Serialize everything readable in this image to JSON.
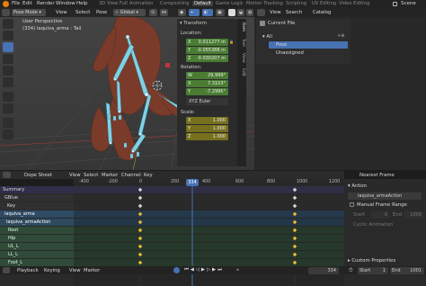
{
  "menus": [
    "File",
    "Edit",
    "Render",
    "Window",
    "Help"
  ],
  "workspace_tabs": [
    "3D View Full",
    "Animation",
    "Compositing",
    "Default",
    "Game Logic",
    "Motion Tracking",
    "Scripting",
    "UV Editing",
    "Video Editing"
  ],
  "active_workspace": "Default",
  "scene_label": "Scene",
  "viewport": {
    "mode": "Pose Mode",
    "menu": [
      "View",
      "Select",
      "Pose"
    ],
    "orientation": "Global",
    "overlay_title": "User Perspective",
    "overlay_subtitle": "(334) laquiva_arma : Tail"
  },
  "transform": {
    "title": "Transform",
    "location_label": "Location:",
    "location": [
      {
        "axis": "X",
        "value": "0.011277 m"
      },
      {
        "axis": "Y",
        "value": "-0.055388 m"
      },
      {
        "axis": "Z",
        "value": "-0.030207 m"
      }
    ],
    "rotation_label": "Rotation:",
    "rotation": [
      {
        "axis": "W",
        "value": "29.999°"
      },
      {
        "axis": "X",
        "value": "7.3103°"
      },
      {
        "axis": "Y",
        "value": "-7.2995°"
      }
    ],
    "rotation_mode": "XYZ Euler",
    "scale_label": "Scale:",
    "scale": [
      {
        "axis": "X",
        "value": "1.000"
      },
      {
        "axis": "Y",
        "value": "1.000"
      },
      {
        "axis": "Z",
        "value": "1.000"
      }
    ]
  },
  "npanel_tabs": [
    "Item",
    "Tool",
    "View",
    "Edit"
  ],
  "outliner": {
    "menu": [
      "View",
      "Search",
      "Catalog"
    ],
    "current_file": "Current File",
    "items": [
      "All",
      "Pose",
      "Unassigned"
    ],
    "selected": "Pose"
  },
  "dopesheet": {
    "mode": "Dope Sheet",
    "menu": [
      "View",
      "Select",
      "Marker",
      "Channel",
      "Key"
    ],
    "snap": "Nearest Frame",
    "current_frame": "334",
    "ruler_labels": [
      "-400",
      "-200",
      "0",
      "200",
      "400",
      "600",
      "800",
      "1000",
      "1200"
    ],
    "channels": [
      "Summary",
      "GBlue",
      "Key",
      "laquiva_arma",
      "laquiva_armaAction",
      "Root",
      "Hip",
      "UL_L",
      "LL_L",
      "Foot_L"
    ]
  },
  "action_panel": {
    "header": "Action",
    "action_name": "laquiva_armaAction",
    "manual_frame_range": "Manual Frame Range",
    "start_label": "Start",
    "start_value": "0",
    "end_label": "End",
    "end_value": "1000",
    "cyclic": "Cyclic Animation",
    "custom_properties": "Custom Properties"
  },
  "footer": {
    "menu": [
      "Playback",
      "Keying",
      "View",
      "Marker"
    ],
    "frame": "334",
    "start_label": "Start",
    "start_value": "1",
    "end_label": "End",
    "end_value": "1001"
  },
  "colors": {
    "accent": "#4772b3",
    "field_green": "#4a7c33",
    "field_yellow": "#77701e",
    "keyframe": "#e6b93c",
    "playhead": "#4772b3"
  }
}
